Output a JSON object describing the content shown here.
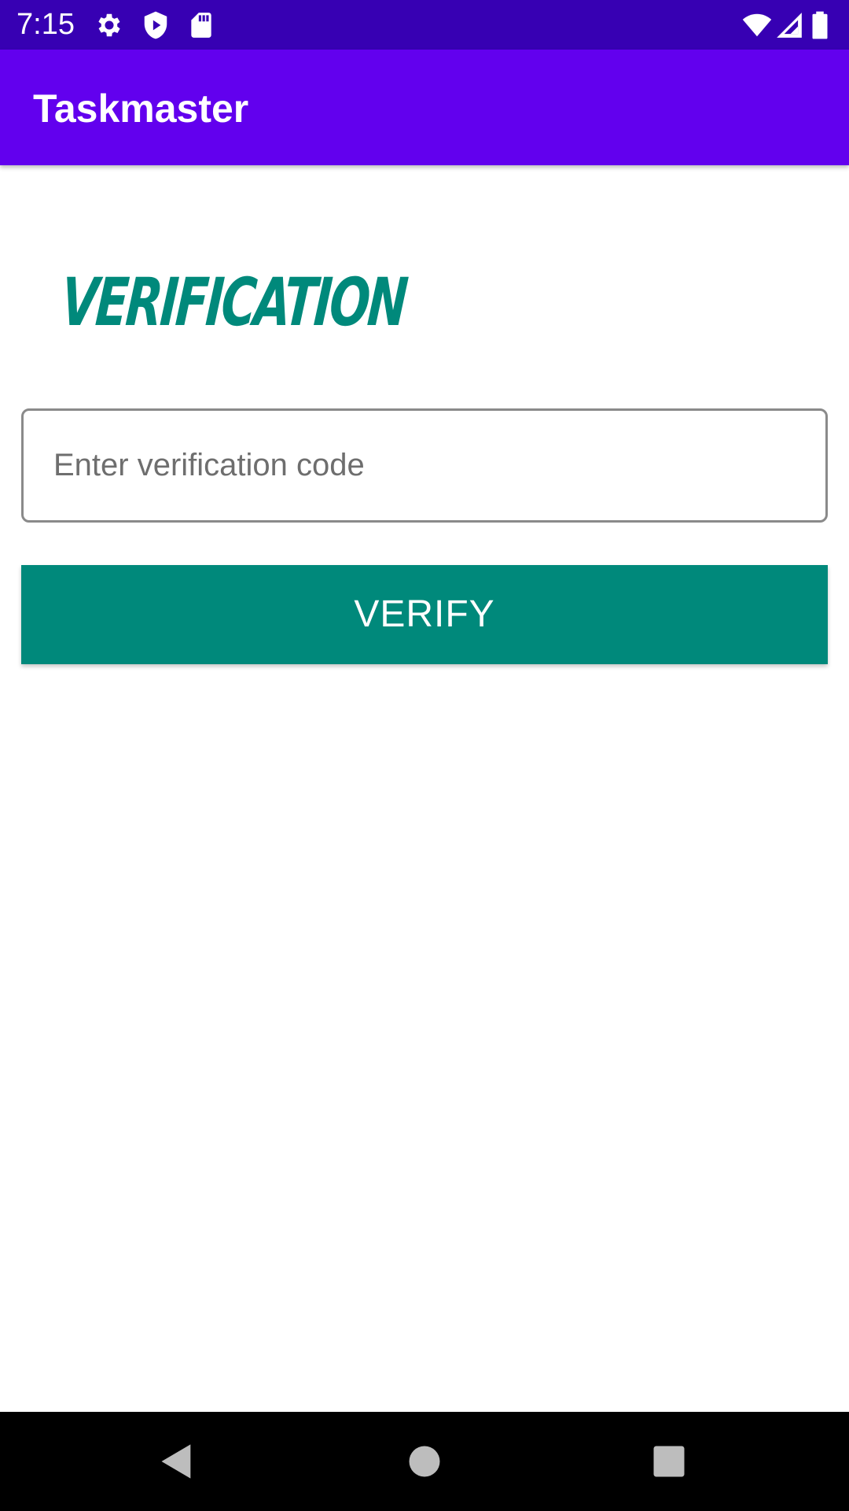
{
  "status_bar": {
    "time": "7:15",
    "icons": [
      "settings-icon",
      "shield-play-icon",
      "sd-card-icon",
      "wifi-icon",
      "signal-icon",
      "battery-icon"
    ]
  },
  "app_bar": {
    "title": "Taskmaster"
  },
  "main": {
    "logo_text": "VERIFICATION",
    "code_input": {
      "placeholder": "Enter verification code",
      "value": ""
    },
    "verify_label": "VERIFY"
  },
  "nav_bar": {
    "buttons": [
      "back-icon",
      "home-icon",
      "recents-icon"
    ]
  },
  "colors": {
    "status_bar": "#3700b3",
    "app_bar": "#6200ee",
    "accent": "#00897b",
    "nav_bar": "#000000"
  }
}
